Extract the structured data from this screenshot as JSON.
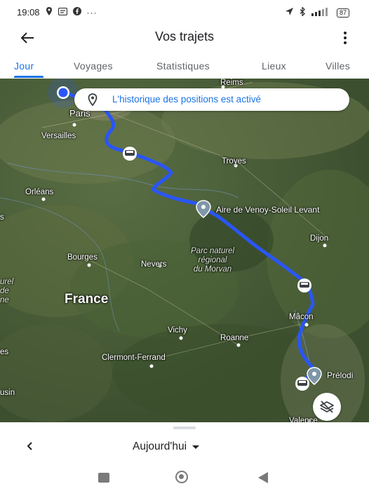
{
  "status_bar": {
    "time": "19:08",
    "battery": "87",
    "left_icons": [
      "location-pin-icon",
      "message-icon",
      "facebook-icon",
      "more-notifications-icon"
    ],
    "right_icons": [
      "navigation-arrow-icon",
      "bluetooth-icon",
      "signal-icon",
      "battery-icon"
    ]
  },
  "header": {
    "title": "Vos trajets"
  },
  "tabs": [
    {
      "label": "Jour",
      "active": true
    },
    {
      "label": "Voyages",
      "active": false
    },
    {
      "label": "Statistiques",
      "active": false
    },
    {
      "label": "Lieux",
      "active": false
    },
    {
      "label": "Villes",
      "active": false
    }
  ],
  "banner": {
    "text": "L'historique des positions est activé"
  },
  "map": {
    "route_color": "#2a56f5",
    "labels": {
      "reims": "Reims",
      "paris": "Paris",
      "versailles": "Versailles",
      "troyes": "Troyes",
      "orleans": "Orléans",
      "aire": "Aire de Venoy-Soleil Levant",
      "dijon": "Dijon",
      "parc": "Parc naturel\nrégional\ndu Morvan",
      "bourges": "Bourges",
      "nevers": "Nevers",
      "france": "France",
      "macon": "Mâcon",
      "vichy": "Vichy",
      "roanne": "Roanne",
      "clermont": "Clermont-Ferrand",
      "prelodi": "Prélodi",
      "valence": "Valence",
      "edge1": "s",
      "edge2": "urel\nde\nne",
      "edge3": "es",
      "edge4": "usin"
    }
  },
  "bottom": {
    "date_label": "Aujourd'hui"
  }
}
